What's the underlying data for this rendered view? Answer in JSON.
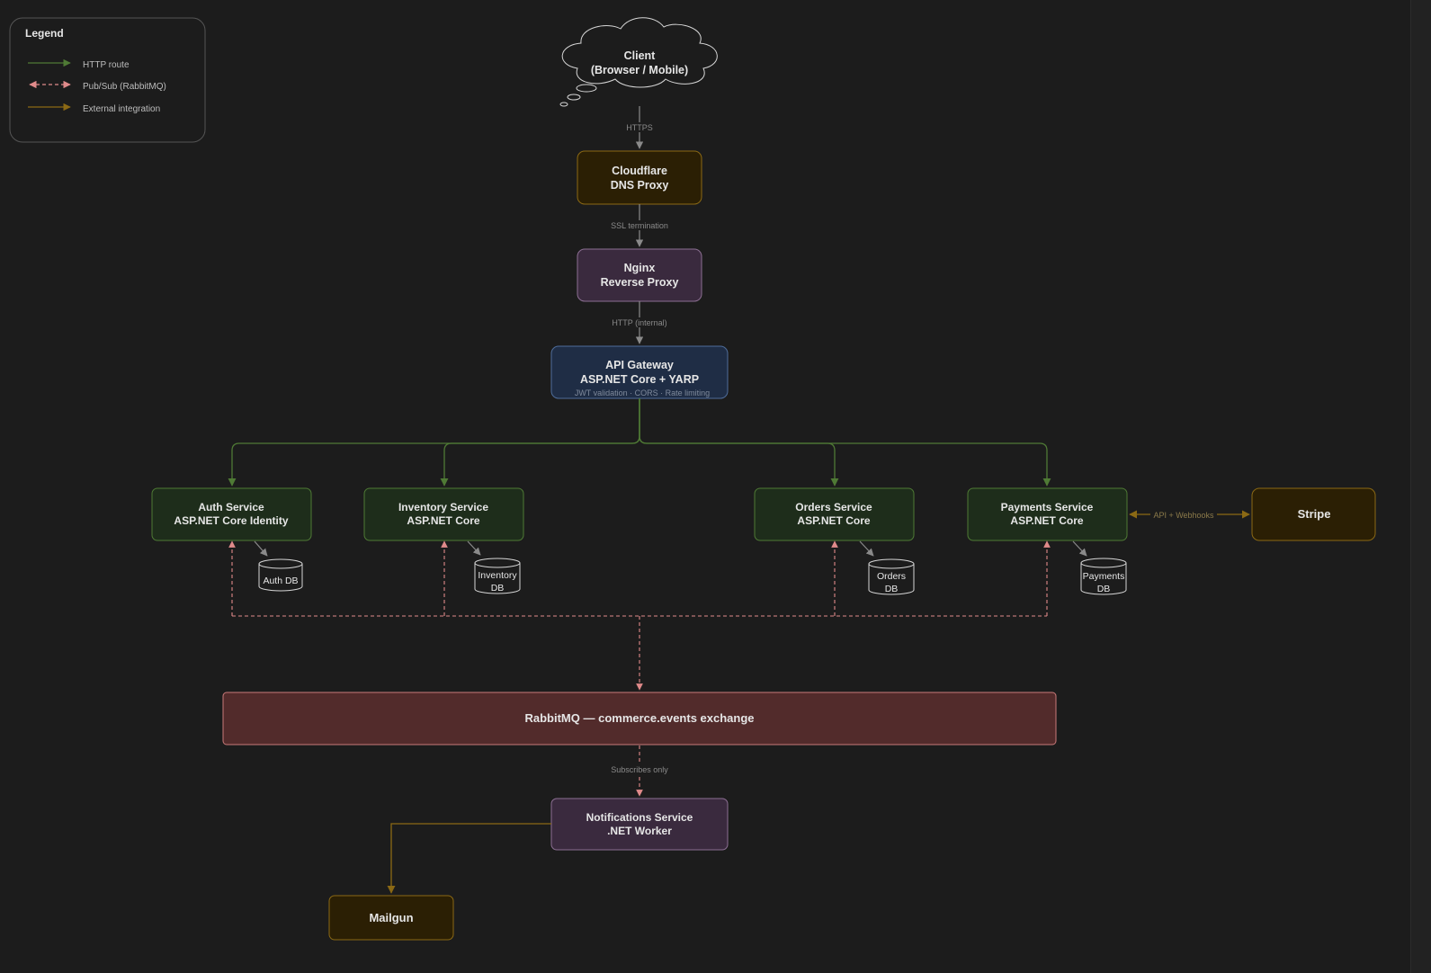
{
  "legend": {
    "title": "Legend",
    "items": [
      {
        "key": "http",
        "label": "HTTP route",
        "color": "#4f7a35",
        "style": "solid"
      },
      {
        "key": "pubsub",
        "label": "Pub/Sub (RabbitMQ)",
        "color": "#e08a8a",
        "style": "dashed"
      },
      {
        "key": "external",
        "label": "External integration",
        "color": "#8b6914",
        "style": "solid"
      }
    ]
  },
  "colors": {
    "background": "#1c1c1c",
    "text": "#e6e6e6",
    "muted_text": "#8a8a8a",
    "http": "#4f7a35",
    "pubsub": "#e08a8a",
    "external": "#8b6914",
    "neutral_arrow": "#8a8a8a"
  },
  "nodes": {
    "client": {
      "line1": "Client",
      "line2": "(Browser / Mobile)"
    },
    "cloudflare": {
      "line1": "Cloudflare",
      "line2": "DNS Proxy"
    },
    "nginx": {
      "line1": "Nginx",
      "line2": "Reverse Proxy"
    },
    "gateway": {
      "line1": "API Gateway",
      "line2": "ASP.NET Core + YARP",
      "note": "JWT validation · CORS · Rate limiting"
    },
    "auth": {
      "line1": "Auth Service",
      "line2": "ASP.NET Core Identity",
      "db_line1": "Auth DB",
      "db_line2": ""
    },
    "inventory": {
      "line1": "Inventory Service",
      "line2": "ASP.NET Core",
      "db_line1": "Inventory",
      "db_line2": "DB"
    },
    "orders": {
      "line1": "Orders Service",
      "line2": "ASP.NET Core",
      "db_line1": "Orders",
      "db_line2": "DB"
    },
    "payments": {
      "line1": "Payments Service",
      "line2": "ASP.NET Core",
      "db_line1": "Payments",
      "db_line2": "DB"
    },
    "stripe": {
      "label": "Stripe"
    },
    "rabbitmq": {
      "label": "RabbitMQ — commerce.events exchange"
    },
    "notifications": {
      "line1": "Notifications Service",
      "line2": ".NET Worker"
    },
    "mailgun": {
      "label": "Mailgun"
    }
  },
  "edges": {
    "client_cloudflare": "HTTPS",
    "cloudflare_nginx": "SSL termination",
    "nginx_gateway": "HTTP (internal)",
    "payments_stripe": "API + Webhooks",
    "rabbit_notifications": "Subscribes only"
  }
}
